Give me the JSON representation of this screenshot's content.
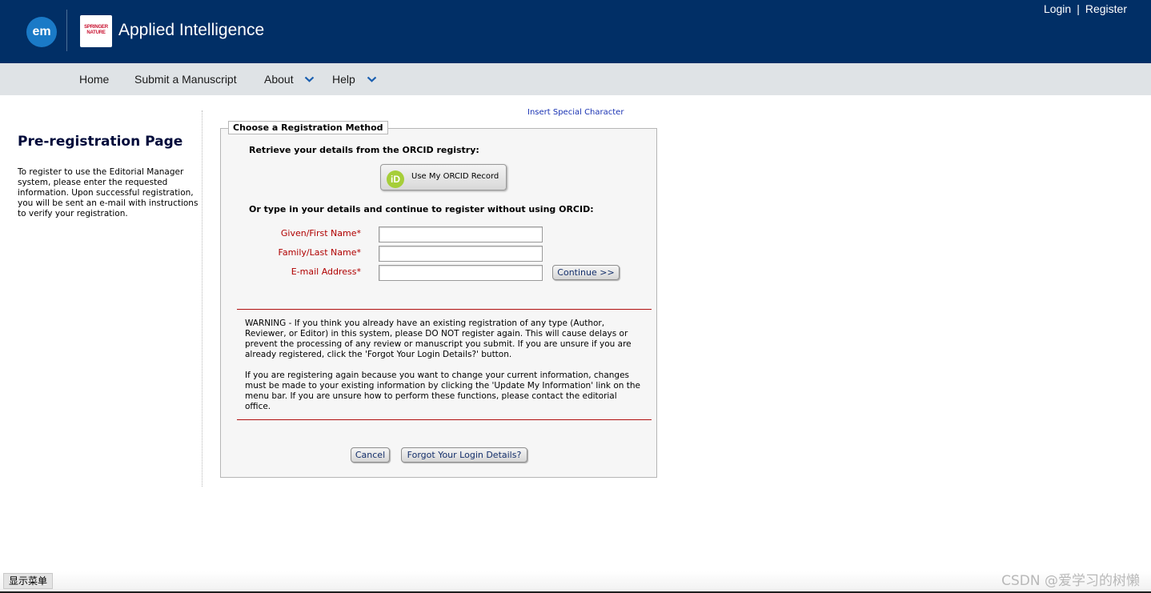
{
  "header": {
    "em_logo": "em",
    "publisher_logo": [
      "SPRINGER",
      "NATURE"
    ],
    "journal_title": "Applied Intelligence",
    "login": "Login",
    "separator": "|",
    "register": "Register"
  },
  "nav": {
    "home": "Home",
    "submit": "Submit a Manuscript",
    "about": "About",
    "help": "Help",
    "dropdown_icon": "chevron-down-icon"
  },
  "sidebar": {
    "title": "Pre-registration Page",
    "intro": "To register to use the Editorial Manager system, please enter the requested information. Upon successful registration, you will be sent an e-mail with instructions to verify your registration."
  },
  "form": {
    "special_char_link": "Insert Special Character",
    "legend": "Choose a Registration Method",
    "orcid_heading": "Retrieve your details from the ORCID registry:",
    "orcid_icon_text": "iD",
    "orcid_button": "Use My ORCID Record",
    "manual_heading": "Or type in your details and continue to register without using ORCID:",
    "given_name_label": "Given/First Name*",
    "family_name_label": "Family/Last Name*",
    "email_label": "E-mail Address*",
    "given_name_value": "",
    "family_name_value": "",
    "email_value": "",
    "continue_button": "Continue >>",
    "warning_1": "WARNING - If you think you already have an existing registration of any type (Author, Reviewer, or Editor) in this system, please DO NOT register again. This will cause delays or prevent the processing of any review or manuscript you submit. If you are unsure if you are already registered, click the 'Forgot Your Login Details?' button.",
    "warning_2": "If you are registering again because you want to change your current information, changes must be made to your existing information by clicking the 'Update My Information' link on the menu bar. If you are unsure how to perform these functions, please contact the editorial office.",
    "cancel_button": "Cancel",
    "forgot_button": "Forgot Your Login Details?"
  },
  "footer": {
    "menu_toggle": "显示菜单",
    "watermark": "CSDN @爱学习的树懒"
  },
  "colors": {
    "header_bg": "#012f66",
    "nav_bg": "#dfe3e6",
    "accent_blue": "#1a7ac7",
    "required_red": "#b00000",
    "orcid_green": "#a6ce39"
  }
}
